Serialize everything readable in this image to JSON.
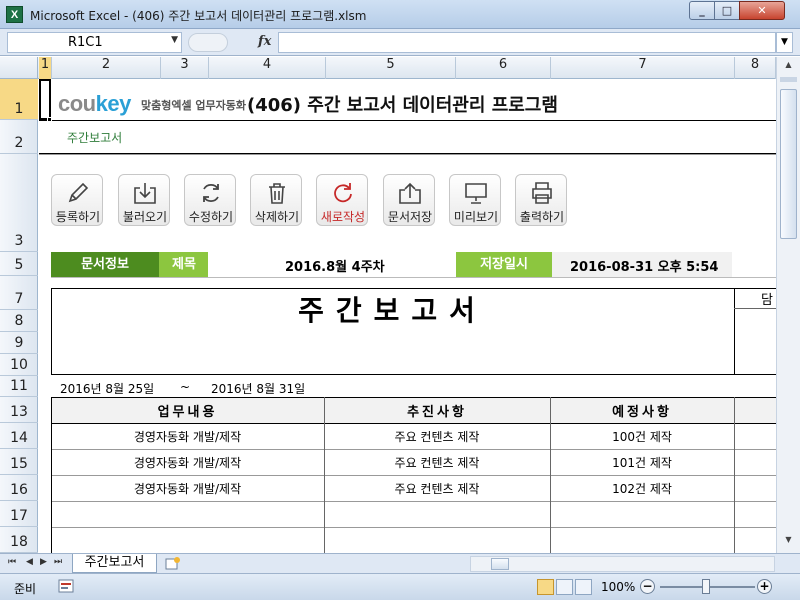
{
  "window": {
    "title": "Microsoft Excel - (406) 주간 보고서 데이터관리 프로그램.xlsm",
    "app_icon": "X",
    "min": "_",
    "max": "□",
    "close": "✕"
  },
  "formula_bar": {
    "name_box": "R1C1",
    "fx": "fx",
    "formula": ""
  },
  "columns": [
    "1",
    "2",
    "3",
    "4",
    "5",
    "6",
    "7",
    "8"
  ],
  "rows": [
    "1",
    "2",
    "3",
    "5",
    "7",
    "8",
    "9",
    "10",
    "11",
    "13",
    "14",
    "15",
    "16",
    "17",
    "18"
  ],
  "header": {
    "brand_cou": "cou",
    "brand_key": "key",
    "brand_sub": "맞춤형엑셀 업무자동화",
    "program_title": "(406) 주간 보고서 데이터관리 프로그램",
    "sheet_label": "주간보고서"
  },
  "toolbar": [
    {
      "label": "등록하기",
      "icon": "pencil-icon"
    },
    {
      "label": "불러오기",
      "icon": "import-icon"
    },
    {
      "label": "수정하기",
      "icon": "refresh-icon"
    },
    {
      "label": "삭제하기",
      "icon": "trash-icon"
    },
    {
      "label": "새로작성",
      "icon": "redo-icon"
    },
    {
      "label": "문서저장",
      "icon": "export-icon"
    },
    {
      "label": "미리보기",
      "icon": "monitor-icon"
    },
    {
      "label": "출력하기",
      "icon": "printer-icon"
    }
  ],
  "docinfo": {
    "label": "문서정보",
    "title_label": "제목",
    "title_value": "2016.8월 4주차",
    "save_label": "저장일시",
    "save_value": "2016-08-31  오후 5:54"
  },
  "report": {
    "title": "주간보고서",
    "manager_label": "담",
    "period_start": "2016년 8월 25일",
    "tilde": "~",
    "period_end": "2016년 8월 31일",
    "columns": [
      "업무내용",
      "추진사항",
      "예정사항"
    ],
    "rows": [
      [
        "경영자동화 개발/제작",
        "주요 컨텐츠 제작",
        "100건 제작"
      ],
      [
        "경영자동화 개발/제작",
        "주요 컨텐츠 제작",
        "101건 제작"
      ],
      [
        "경영자동화 개발/제작",
        "주요 컨텐츠 제작",
        "102건 제작"
      ]
    ]
  },
  "tabs": {
    "active": "주간보고서"
  },
  "status": {
    "ready": "준비",
    "zoom": "100%"
  },
  "colors": {
    "doc_green": "#4d8c1f",
    "light_green": "#8cc63f",
    "label_green": "#2f7d3a",
    "accent_red": "#c62828"
  }
}
